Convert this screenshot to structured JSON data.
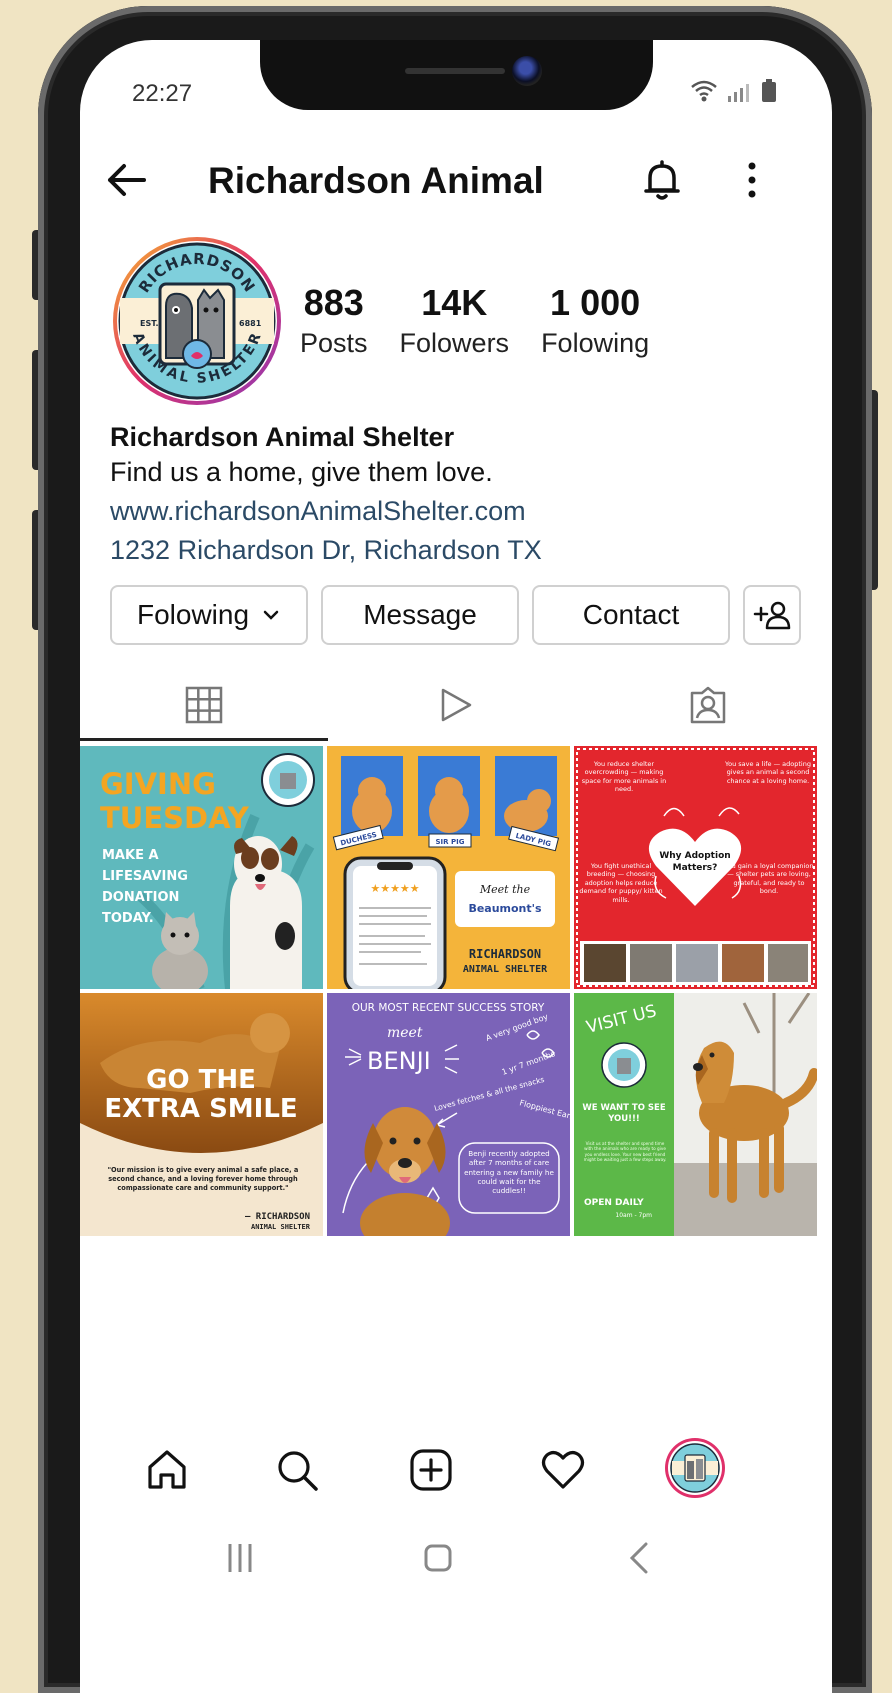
{
  "status": {
    "time": "22:27"
  },
  "header": {
    "title": "Richardson Animal"
  },
  "profile": {
    "stats": [
      {
        "value": "883",
        "label": "Posts"
      },
      {
        "value": "14K",
        "label": "Folowers"
      },
      {
        "value": "1 000",
        "label": "Folowing"
      }
    ],
    "avatar_text": {
      "top": "RICHARDSON",
      "bottom": "ANIMAL SHELTER",
      "left": "EST.",
      "right": "6881"
    },
    "bio": {
      "name": "Richardson Animal Shelter",
      "tagline": "Find us a home, give them love.",
      "website": "www.richardsonAnimalShelter.com",
      "address": "1232 Richardson Dr, Richardson TX"
    }
  },
  "actions": {
    "following": "Folowing",
    "message": "Message",
    "contact": "Contact"
  },
  "posts": [
    {
      "title1": "GIVING",
      "title2": "TUESDAY",
      "lines": [
        "MAKE A",
        "LIFESAVING",
        "DONATION",
        "TODAY."
      ]
    },
    {
      "names": [
        "DUCHESS",
        "SIR PIG",
        "LADY PIG"
      ],
      "meet": "Meet the",
      "family": "Beaumont's",
      "stars": "★★★★★",
      "brand1": "RICHARDSON",
      "brand2": "ANIMAL SHELTER"
    },
    {
      "center1": "Why Adoption",
      "center2": "Matters?",
      "tl": "You reduce shelter overcrowding — making space for more animals in need.",
      "tr": "You save a life — adopting gives an animal a second chance at a loving home.",
      "bl": "You fight unethical breeding — choosing adoption helps reduce demand for puppy/ kitten mills.",
      "br": "You gain a loyal companion — shelter pets are loving, grateful, and ready to bond."
    },
    {
      "title1": "GO THE",
      "title2": "EXTRA SMILE",
      "quote": "\"Our mission is to give every animal a safe place, a second chance, and a loving forever home through compassionate care and community support.\"",
      "sig1": "— RICHARDSON",
      "sig2": "ANIMAL SHELTER"
    },
    {
      "header": "OUR MOST RECENT SUCCESS STORY",
      "meet": "meet",
      "name": "BENJI",
      "note1": "A very good boy",
      "note2": "1 yr 7 months",
      "note3": "Loves fetches & all the snacks",
      "note4": "Floppiest Ears",
      "story": "Benji recently adopted after 7 months of care entering a new family he could wait for the cuddles!!"
    },
    {
      "visit": "VISIT US",
      "want": "WE WANT TO SEE YOU!!!",
      "small": "Visit us at the shelter and spend time with the animals who are ready to give you endless love. Your new best friend might be waiting just a few steps away.",
      "open": "OPEN DAILY",
      "hours": "10am - 7pm"
    }
  ]
}
